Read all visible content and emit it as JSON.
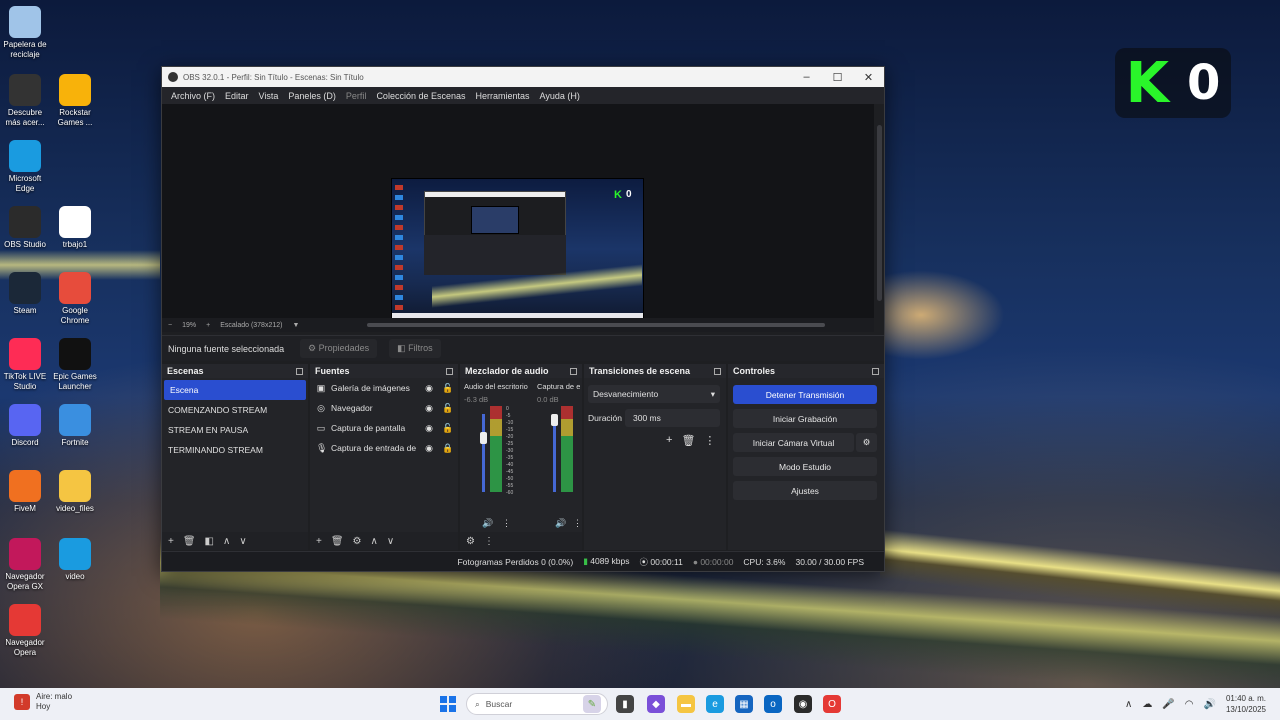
{
  "desktop": {
    "icons": [
      {
        "label": "Papelera de reciclaje",
        "icon": "recycle-bin-icon",
        "color": "#a0c4e8"
      },
      {
        "label": "Descubre más acer...",
        "icon": "compass-icon",
        "color": "#333333"
      },
      {
        "label": "Rockstar Games ...",
        "icon": "rockstar-icon",
        "color": "#f8b20a"
      },
      {
        "label": "Microsoft Edge",
        "icon": "edge-icon",
        "color": "#1a9be0"
      },
      {
        "label": "OBS Studio",
        "icon": "obs-icon",
        "color": "#2b2b2b"
      },
      {
        "label": "trbajo1",
        "icon": "document-icon",
        "color": "#ffffff"
      },
      {
        "label": "Steam",
        "icon": "steam-icon",
        "color": "#1b2838"
      },
      {
        "label": "Google Chrome",
        "icon": "chrome-icon",
        "color": "#e74c3c"
      },
      {
        "label": "TikTok LIVE Studio",
        "icon": "tiktok-icon",
        "color": "#fe2c55"
      },
      {
        "label": "Epic Games Launcher",
        "icon": "epic-icon",
        "color": "#111111"
      },
      {
        "label": "Discord",
        "icon": "discord-icon",
        "color": "#5865f2"
      },
      {
        "label": "Fortnite",
        "icon": "fortnite-icon",
        "color": "#3a8fe0"
      },
      {
        "label": "FiveM",
        "icon": "fivem-icon",
        "color": "#f07020"
      },
      {
        "label": "video_files",
        "icon": "folder-icon",
        "color": "#f5c542"
      },
      {
        "label": "Navegador Opera GX",
        "icon": "opera-gx-icon",
        "color": "#c2185b"
      },
      {
        "label": "video",
        "icon": "edge-icon",
        "color": "#1a9be0"
      },
      {
        "label": "Navegador Opera",
        "icon": "opera-icon",
        "color": "#e53935"
      }
    ]
  },
  "overlay": {
    "letter": "K",
    "count": "0"
  },
  "obs": {
    "title": "OBS 32.0.1 - Perfil: Sin Título - Escenas: Sin Título",
    "menu": [
      "Archivo (F)",
      "Editar",
      "Vista",
      "Paneles (D)",
      "Perfil",
      "Colección de Escenas",
      "Herramientas",
      "Ayuda (H)"
    ],
    "preview": {
      "mini_k": "K",
      "mini_count": "0"
    },
    "zoom": {
      "percent": "19%",
      "scale_label": "Escalado (378x212)"
    },
    "source_bar": {
      "no_source": "Ninguna fuente seleccionada",
      "properties": "Propiedades",
      "filters": "Filtros"
    },
    "docks": {
      "scenes": {
        "title": "Escenas",
        "items": [
          "Escena",
          "COMENZANDO STREAM",
          "STREAM EN PAUSA",
          "TERMINANDO STREAM"
        ],
        "active_index": 0
      },
      "sources": {
        "title": "Fuentes",
        "items": [
          {
            "label": "Galería de imágenes",
            "icon": "image-gallery-icon",
            "locked": false
          },
          {
            "label": "Navegador",
            "icon": "globe-icon",
            "locked": false
          },
          {
            "label": "Captura de pantalla",
            "icon": "monitor-icon",
            "locked": false
          },
          {
            "label": "Captura de entrada de audio",
            "icon": "microphone-icon",
            "locked": true
          }
        ]
      },
      "mixer": {
        "title": "Mezclador de audio",
        "channels": [
          {
            "name": "Audio del escritorio",
            "db": "-6.3 dB"
          },
          {
            "name": "Captura de entrada de audio",
            "db": "0.0 dB"
          }
        ],
        "scale": [
          "0",
          "-5",
          "-10",
          "-15",
          "-20",
          "-25",
          "-30",
          "-35",
          "-40",
          "-45",
          "-50",
          "-55",
          "-60"
        ]
      },
      "transitions": {
        "title": "Transiciones de escena",
        "selected": "Desvanecimiento",
        "duration_label": "Duración",
        "duration_value": "300 ms"
      },
      "controls": {
        "title": "Controles",
        "stop_stream": "Detener Transmisión",
        "start_recording": "Iniciar Grabación",
        "start_virtual_cam": "Iniciar Cámara Virtual",
        "studio_mode": "Modo Estudio",
        "settings": "Ajustes"
      }
    },
    "status": {
      "dropped_frames": "Fotogramas Perdidos 0 (0.0%)",
      "bitrate": "4089 kbps",
      "stream_time": "00:00:11",
      "record_time": "00:00:00",
      "cpu": "CPU: 3.6%",
      "fps": "30.00 / 30.00 FPS"
    }
  },
  "taskbar": {
    "weather_title": "Aire: malo",
    "weather_sub": "Hoy",
    "search_placeholder": "Buscar",
    "time": "01:40 a. m.",
    "date": "13/10/2025"
  }
}
